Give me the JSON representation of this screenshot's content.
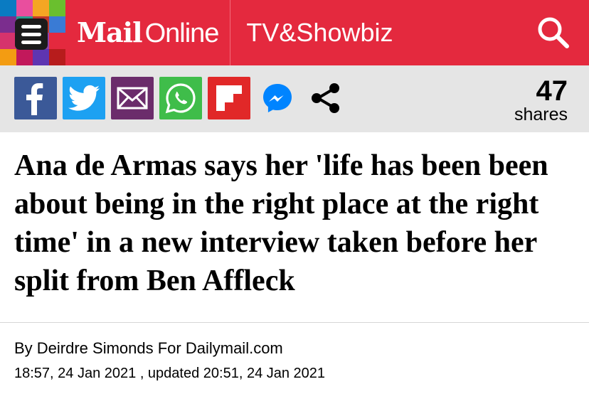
{
  "header": {
    "logo_bold": "Mail",
    "logo_light": "Online",
    "section": "TV&Showbiz",
    "menu_icon": "hamburger-menu-icon",
    "search_icon": "search-icon",
    "background": "#e4293e"
  },
  "share": {
    "buttons": [
      {
        "network": "facebook",
        "icon": "facebook-icon",
        "color": "#3b5998"
      },
      {
        "network": "twitter",
        "icon": "twitter-icon",
        "color": "#1da1f2"
      },
      {
        "network": "email",
        "icon": "email-icon",
        "color": "#6b2c6b"
      },
      {
        "network": "whatsapp",
        "icon": "whatsapp-icon",
        "color": "#3fbd4a"
      },
      {
        "network": "flipboard",
        "icon": "flipboard-icon",
        "color": "#e12828"
      },
      {
        "network": "messenger",
        "icon": "messenger-icon",
        "color": "#0084ff"
      },
      {
        "network": "more",
        "icon": "share-icon",
        "color": "#000000"
      }
    ],
    "count": "47",
    "count_label": "shares"
  },
  "article": {
    "headline": "Ana de Armas says her 'life has been been about being in the right place at the right time' in a new interview taken before her split from Ben Affleck",
    "byline": "By Deirdre Simonds For Dailymail.com",
    "dateline": "18:57, 24 Jan 2021 , updated 20:51, 24 Jan 2021"
  }
}
